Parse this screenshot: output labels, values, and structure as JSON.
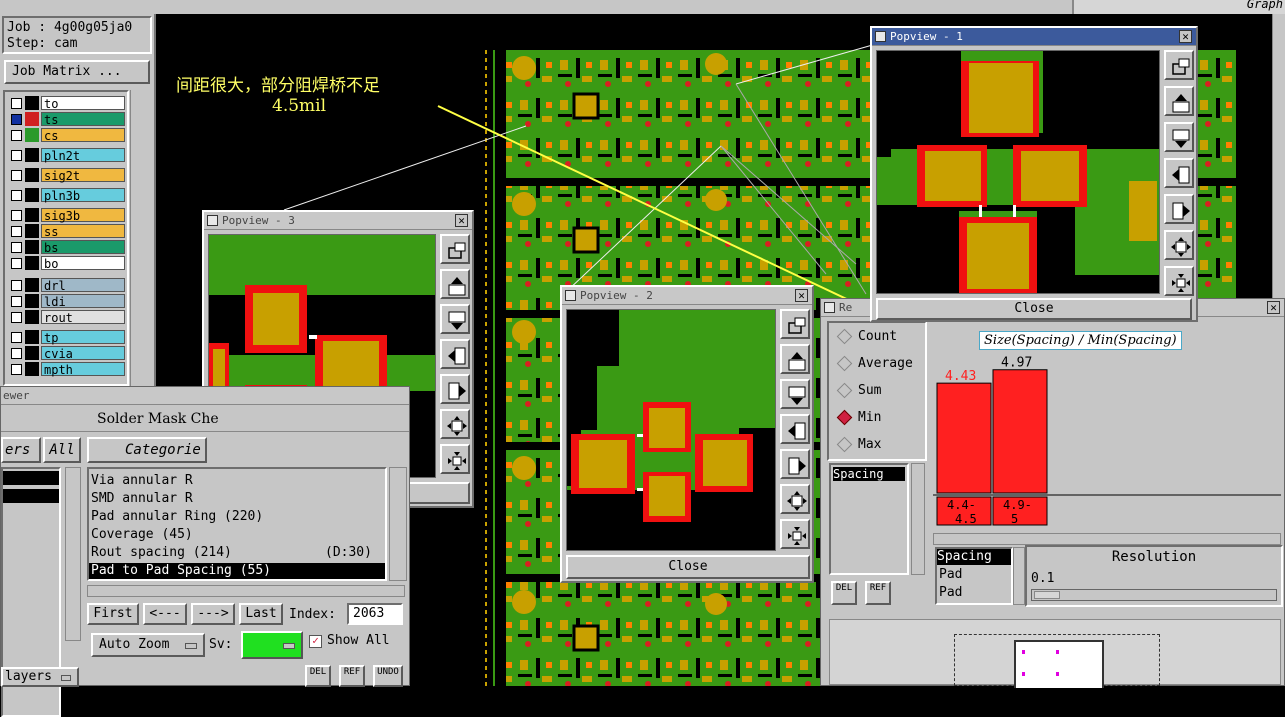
{
  "job_panel": {
    "job_label": "Job : 4g00g05ja0",
    "step_label": "Step: cam",
    "job_matrix_button": "Job Matrix ..."
  },
  "layers": [
    {
      "name": "to",
      "color": "#ffffff",
      "text_color": "#000"
    },
    {
      "name": "ts",
      "color": "#1a9a6a",
      "text_color": "#000"
    },
    {
      "name": "cs",
      "color": "#f0b840",
      "text_color": "#000"
    },
    {
      "name": "pln2t",
      "color": "#66ccdd",
      "text_color": "#000"
    },
    {
      "name": "sig2t",
      "color": "#f0b840",
      "text_color": "#000"
    },
    {
      "name": "pln3b",
      "color": "#66ccdd",
      "text_color": "#000"
    },
    {
      "name": "sig3b",
      "color": "#f0b840",
      "text_color": "#000"
    },
    {
      "name": "ss",
      "color": "#f0b840",
      "text_color": "#000"
    },
    {
      "name": "bs",
      "color": "#1a9a6a",
      "text_color": "#000"
    },
    {
      "name": "bo",
      "color": "#ffffff",
      "text_color": "#000"
    },
    {
      "name": "drl",
      "color": "#9fb8c8",
      "text_color": "#000"
    },
    {
      "name": "ldi",
      "color": "#9fb8c8",
      "text_color": "#000"
    },
    {
      "name": "rout",
      "color": "#e0e0e0",
      "text_color": "#000"
    },
    {
      "name": "tp",
      "color": "#66ccdd",
      "text_color": "#000"
    },
    {
      "name": "cvia",
      "color": "#66ccdd",
      "text_color": "#000"
    },
    {
      "name": "mpth",
      "color": "#66ccdd",
      "text_color": "#000"
    }
  ],
  "annotation": {
    "line1": "间距很大，部分阻焊桥不足",
    "line2": "4.5mil",
    "color": "#ffff66"
  },
  "checker": {
    "window_title": "ewer",
    "header": "Solder Mask Che",
    "layers_tab": "ers",
    "all_tab": "All",
    "category_header": "Categorie",
    "categories": [
      {
        "label": "Via annular R",
        "count": ""
      },
      {
        "label": "SMD annular R",
        "count": ""
      },
      {
        "label": "Pad annular Ring (220)",
        "count": ""
      },
      {
        "label": "Coverage (45)",
        "count": ""
      },
      {
        "label": "Rout spacing (214)",
        "count": "(D:30)"
      },
      {
        "label": "Pad to Pad Spacing (55)",
        "count": ""
      }
    ],
    "first_btn": "First",
    "prev_btn": "<---",
    "next_btn": "--->",
    "last_btn": "Last",
    "index_label": "Index:",
    "index_value": "2063",
    "autozoom_btn": "Auto Zoom",
    "sv_label": "Sv:",
    "show_all_label": "Show All",
    "layers_btn": "layers",
    "del_label": "DEL",
    "ref_label": "REF",
    "undo_label": "UNDO"
  },
  "popview1": {
    "title": "Popview - 1",
    "close": "Close"
  },
  "popview2": {
    "title": "Popview - 2",
    "close": "Close"
  },
  "popview3": {
    "title": "Popview - 3",
    "close": "Close"
  },
  "results": {
    "title": "Re",
    "modes": [
      {
        "label": "Count",
        "selected": false
      },
      {
        "label": "Average",
        "selected": false
      },
      {
        "label": "Sum",
        "selected": false
      },
      {
        "label": "Min",
        "selected": true
      },
      {
        "label": "Max",
        "selected": false
      }
    ],
    "list_item": "Spacing",
    "del_label": "DEL",
    "ref_label": "REF",
    "chart_title": "Size(Spacing) / Min(Spacing)",
    "table_col1": "Spacing",
    "table_rows": [
      "Pad",
      "Pad"
    ],
    "resolution_label": "Resolution",
    "resolution_value": "0.1"
  },
  "top_right_text": "Graph",
  "chart_data": {
    "type": "bar",
    "title": "Size(Spacing) / Min(Spacing)",
    "categories": [
      "4.4-4.5",
      "4.9-5"
    ],
    "values": [
      4.43,
      4.97
    ],
    "value_labels": [
      "4.43",
      "4.97"
    ],
    "value_label_colors": [
      "#ff2020",
      "#000000"
    ],
    "bar_color": "#ff2020"
  }
}
